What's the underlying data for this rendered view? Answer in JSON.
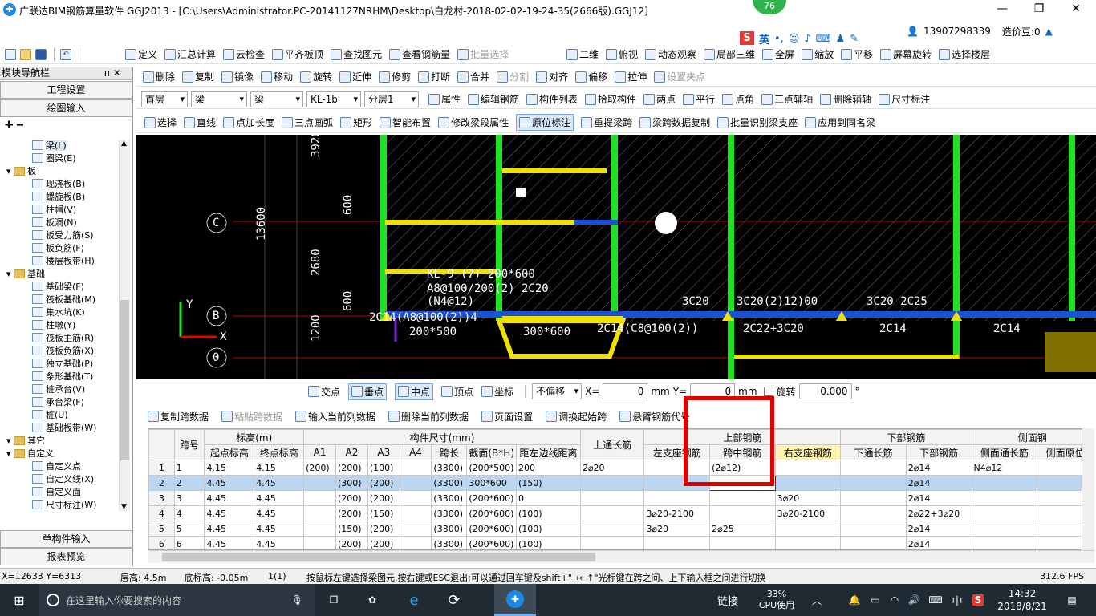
{
  "window": {
    "title": "广联达BIM钢筋算量软件 GGJ2013 - [C:\\Users\\Administrator.PC-20141127NRHM\\Desktop\\白龙村-2018-02-02-19-24-35(2666版).GGJ12]",
    "badge": "76",
    "phone": "13907298339",
    "cost_label": "造价豆:0"
  },
  "ime": {
    "label": "英"
  },
  "menu": [
    {
      "label": "定义"
    },
    {
      "label": "汇总计算"
    },
    {
      "label": "云检查"
    },
    {
      "label": "平齐板顶"
    },
    {
      "label": "查找图元"
    },
    {
      "label": "查看钢筋量"
    },
    {
      "label": "批量选择"
    },
    {
      "label": "二维"
    },
    {
      "label": "俯视"
    },
    {
      "label": "动态观察"
    },
    {
      "label": "局部三维"
    },
    {
      "label": "全屏"
    },
    {
      "label": "缩放"
    },
    {
      "label": "平移"
    },
    {
      "label": "屏幕旋转"
    },
    {
      "label": "选择楼层"
    }
  ],
  "edit_toolbar": [
    {
      "label": "删除"
    },
    {
      "label": "复制"
    },
    {
      "label": "镜像"
    },
    {
      "label": "移动"
    },
    {
      "label": "旋转"
    },
    {
      "label": "延伸"
    },
    {
      "label": "修剪"
    },
    {
      "label": "打断"
    },
    {
      "label": "合并"
    },
    {
      "label": "分割"
    },
    {
      "label": "对齐"
    },
    {
      "label": "偏移"
    },
    {
      "label": "拉伸"
    },
    {
      "label": "设置夹点"
    }
  ],
  "layer_bar": {
    "floor": "首层",
    "cat": "梁",
    "type": "梁",
    "element": "KL-1b",
    "sublayer": "分层1",
    "buttons": [
      {
        "label": "属性"
      },
      {
        "label": "编辑钢筋"
      },
      {
        "label": "构件列表"
      },
      {
        "label": "拾取构件"
      },
      {
        "label": "两点"
      },
      {
        "label": "平行"
      },
      {
        "label": "点角"
      },
      {
        "label": "三点辅轴"
      },
      {
        "label": "删除辅轴"
      },
      {
        "label": "尺寸标注"
      }
    ]
  },
  "draw_bar": [
    {
      "label": "选择"
    },
    {
      "label": "直线"
    },
    {
      "label": "点加长度"
    },
    {
      "label": "三点画弧"
    },
    {
      "label": "矩形"
    },
    {
      "label": "智能布置"
    },
    {
      "label": "修改梁段属性"
    },
    {
      "label": "原位标注"
    },
    {
      "label": "重提梁跨"
    },
    {
      "label": "梁跨数据复制"
    },
    {
      "label": "批量识别梁支座"
    },
    {
      "label": "应用到同名梁"
    }
  ],
  "nav": {
    "header": "模块导航栏",
    "pin": "ᴨ ✕",
    "tab_project": "工程设置",
    "tab_draw": "绘图输入",
    "tab_single": "单构件输入",
    "tab_report": "报表预览"
  },
  "tree": [
    {
      "label": "梁(L)",
      "indent": 2,
      "kind": "item",
      "selected": true
    },
    {
      "label": "圈梁(E)",
      "indent": 2,
      "kind": "item"
    },
    {
      "label": "板",
      "indent": 1,
      "kind": "folder"
    },
    {
      "label": "现浇板(B)",
      "indent": 2,
      "kind": "item"
    },
    {
      "label": "螺旋板(B)",
      "indent": 2,
      "kind": "item"
    },
    {
      "label": "柱帽(V)",
      "indent": 2,
      "kind": "item"
    },
    {
      "label": "板洞(N)",
      "indent": 2,
      "kind": "item"
    },
    {
      "label": "板受力筋(S)",
      "indent": 2,
      "kind": "item"
    },
    {
      "label": "板负筋(F)",
      "indent": 2,
      "kind": "item"
    },
    {
      "label": "楼层板带(H)",
      "indent": 2,
      "kind": "item"
    },
    {
      "label": "基础",
      "indent": 1,
      "kind": "folder"
    },
    {
      "label": "基础梁(F)",
      "indent": 2,
      "kind": "item"
    },
    {
      "label": "筏板基础(M)",
      "indent": 2,
      "kind": "item"
    },
    {
      "label": "集水坑(K)",
      "indent": 2,
      "kind": "item"
    },
    {
      "label": "柱墩(Y)",
      "indent": 2,
      "kind": "item"
    },
    {
      "label": "筏板主筋(R)",
      "indent": 2,
      "kind": "item"
    },
    {
      "label": "筏板负筋(X)",
      "indent": 2,
      "kind": "item"
    },
    {
      "label": "独立基础(P)",
      "indent": 2,
      "kind": "item"
    },
    {
      "label": "条形基础(T)",
      "indent": 2,
      "kind": "item"
    },
    {
      "label": "桩承台(V)",
      "indent": 2,
      "kind": "item"
    },
    {
      "label": "承台梁(F)",
      "indent": 2,
      "kind": "item"
    },
    {
      "label": "桩(U)",
      "indent": 2,
      "kind": "item"
    },
    {
      "label": "基础板带(W)",
      "indent": 2,
      "kind": "item"
    },
    {
      "label": "其它",
      "indent": 1,
      "kind": "folder"
    },
    {
      "label": "自定义",
      "indent": 1,
      "kind": "folder"
    },
    {
      "label": "自定义点",
      "indent": 2,
      "kind": "item"
    },
    {
      "label": "自定义线(X)",
      "indent": 2,
      "kind": "item"
    },
    {
      "label": "自定义面",
      "indent": 2,
      "kind": "item"
    },
    {
      "label": "尺寸标注(W)",
      "indent": 2,
      "kind": "item"
    }
  ],
  "cad": {
    "dims": [
      "3920",
      "13600",
      "600",
      "2680",
      "600",
      "1200"
    ],
    "axes": [
      "C",
      "B",
      "0"
    ],
    "labels": [
      "KL-9 (7) 200*600",
      "A8@100/200(2) 2C20",
      "(N4@12)",
      "2C14(A8@100(2))4",
      "200*500",
      "300*600",
      "2C14(C8@100(2))",
      "3C20",
      "3C20(2)12)00",
      "3C20 2C25",
      "2C22+3C20",
      "2C14",
      "2C14"
    ],
    "axis_y": "Y",
    "axis_x": "X"
  },
  "snap": {
    "items": [
      {
        "label": "交点"
      },
      {
        "label": "垂点"
      },
      {
        "label": "中点"
      },
      {
        "label": "顶点"
      },
      {
        "label": "坐标"
      }
    ],
    "offset": "不偏移",
    "x_label": "X=",
    "x_val": "0",
    "unit1": "mm",
    "y_label": "Y=",
    "y_val": "0",
    "unit2": "mm",
    "rotate_label": "旋转",
    "rotate_val": "0.000",
    "deg": "°"
  },
  "grid_toolbar": [
    {
      "label": "复制跨数据"
    },
    {
      "label": "粘贴跨数据"
    },
    {
      "label": "输入当前列数据"
    },
    {
      "label": "删除当前列数据"
    },
    {
      "label": "页面设置"
    },
    {
      "label": "调换起始跨"
    },
    {
      "label": "悬臂钢筋代号"
    }
  ],
  "table": {
    "group_headers": {
      "span": "跨号",
      "elev": "标高(m)",
      "section": "构件尺寸(mm)",
      "top_through": "上通长筋",
      "top_bar": "上部钢筋",
      "bottom_bar": "下部钢筋",
      "side": "侧面钢"
    },
    "headers": [
      "起点标高",
      "终点标高",
      "A1",
      "A2",
      "A3",
      "A4",
      "跨长",
      "截面(B*H)",
      "距左边线距离",
      "左支座钢筋",
      "跨中钢筋",
      "右支座钢筋",
      "下通长筋",
      "下部钢筋",
      "侧面通长筋",
      "侧面原位"
    ],
    "rows": [
      [
        "1",
        "1",
        "4.15",
        "4.15",
        "(200)",
        "(200)",
        "(100)",
        "",
        "(3300)",
        "(200*500)",
        "200",
        "2⌀20",
        "",
        "(2⌀12)",
        "",
        "",
        "2⌀14",
        "N4⌀12",
        ""
      ],
      [
        "2",
        "2",
        "4.45",
        "4.45",
        "",
        "(300)",
        "(200)",
        "",
        "(3300)",
        "300*600",
        "(150)",
        "",
        "",
        "",
        "",
        "",
        "2⌀14",
        "",
        ""
      ],
      [
        "3",
        "3",
        "4.45",
        "4.45",
        "",
        "(200)",
        "(200)",
        "",
        "(3300)",
        "(200*600)",
        "0",
        "",
        "",
        "",
        "3⌀20",
        "",
        "2⌀14",
        "",
        ""
      ],
      [
        "4",
        "4",
        "4.45",
        "4.45",
        "",
        "(200)",
        "(150)",
        "",
        "(3300)",
        "(200*600)",
        "(100)",
        "",
        "3⌀20-2100",
        "",
        "3⌀20-2100",
        "",
        "2⌀22+3⌀20",
        "",
        ""
      ],
      [
        "5",
        "5",
        "4.45",
        "4.45",
        "",
        "(150)",
        "(200)",
        "",
        "(3300)",
        "(200*600)",
        "(100)",
        "",
        "3⌀20",
        "2⌀25",
        "",
        "",
        "2⌀14",
        "",
        ""
      ],
      [
        "6",
        "6",
        "4.45",
        "4.45",
        "",
        "(200)",
        "(200)",
        "",
        "(3300)",
        "(200*600)",
        "(100)",
        "",
        "",
        "",
        "",
        "",
        "2⌀14",
        "",
        ""
      ]
    ]
  },
  "status": {
    "coords": "X=12633 Y=6313",
    "floor_h": "层高: 4.5m",
    "base_h": "底标高: -0.05m",
    "count": "1(1)",
    "hint": "按鼠标左键选择梁图元,按右键或ESC退出;可以通过回车键及shift+\"→←↑\"光标键在跨之间、上下输入框之间进行切换",
    "fps": "312.6 FPS"
  },
  "taskbar": {
    "search": "在这里输入你要搜索的内容",
    "link": "链接",
    "cpu_pct": "33%",
    "cpu_label": "CPU使用",
    "lang": "中",
    "time": "14:32",
    "date": "2018/8/21"
  }
}
